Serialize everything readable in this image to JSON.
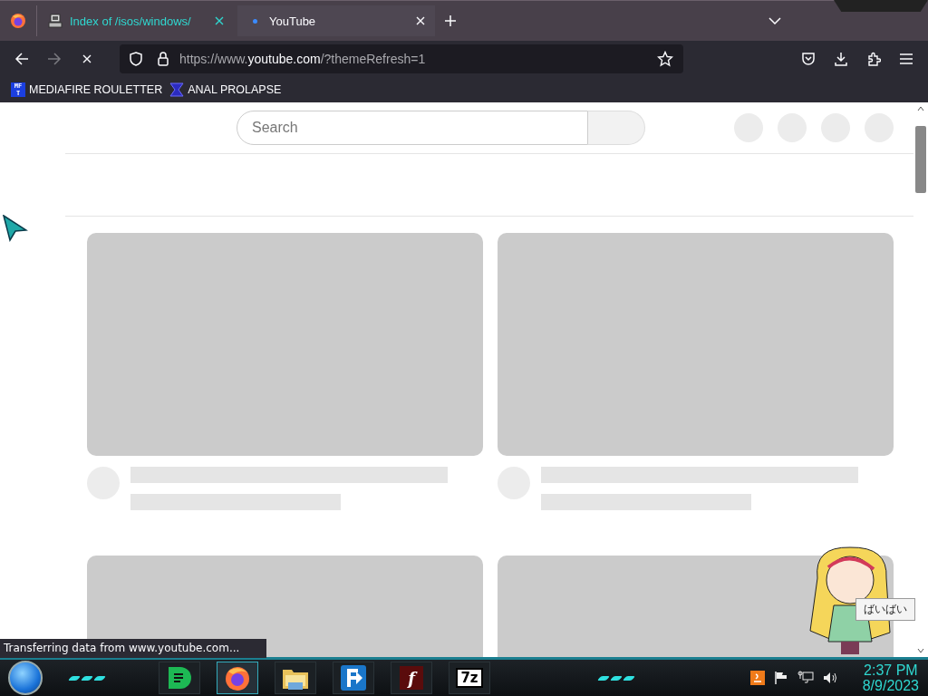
{
  "browser": {
    "tabs": [
      {
        "label": "Index of /isos/windows/",
        "selected": false,
        "loading": false
      },
      {
        "label": "YouTube",
        "selected": true,
        "loading": true
      }
    ],
    "nav": {
      "forward_disabled": true,
      "loading": true
    },
    "address": {
      "prefix": "https://www.",
      "domain": "youtube.com",
      "suffix": "/?themeRefresh=1"
    },
    "bookmarks": [
      {
        "label": "MEDIAFIRE ROULETTER",
        "kind": "mf",
        "icon_lines": [
          "MF",
          "T"
        ]
      },
      {
        "label": "ANAL PROLAPSE",
        "kind": "sigma"
      }
    ]
  },
  "page": {
    "search": {
      "placeholder": "Search"
    }
  },
  "status": "Transferring data from www.youtube.com...",
  "mascot": {
    "speech": "ばいばい"
  },
  "taskbar": {
    "apps": [
      {
        "kind": "green"
      },
      {
        "kind": "firefox",
        "active": true
      },
      {
        "kind": "folder"
      },
      {
        "kind": "arrow"
      },
      {
        "kind": "flash",
        "label": "f"
      },
      {
        "kind": "sevenzip",
        "label": "7z"
      }
    ],
    "clock": {
      "time": "2:37 PM",
      "date": "8/9/2023"
    }
  }
}
